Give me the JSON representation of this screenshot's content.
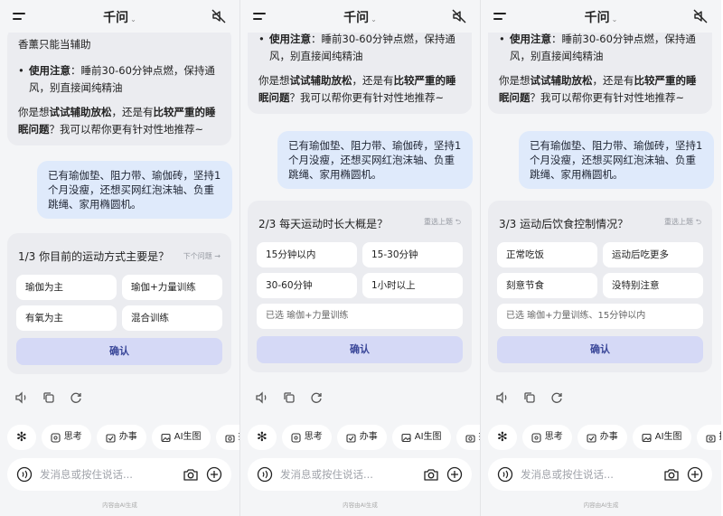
{
  "app": {
    "title": "千问",
    "title_caret": "⌄"
  },
  "common": {
    "input_placeholder": "发消息或按住说话...",
    "footer": "内容由AI生成",
    "chips": [
      "",
      "思考",
      "办事",
      "AI生图",
      "拍题"
    ],
    "confirm_label": "确认",
    "accent_color": "#d5d9f6",
    "user_bubble_color": "#dfeafb"
  },
  "screen1": {
    "ai_top": "香薰只能当辅助",
    "bullet_label": "使用注意",
    "bullet_text": "：睡前30-60分钟点燃，保持通风，别直接闻纯精油",
    "ask_pre": "你是想",
    "ask_b1": "试试辅助放松",
    "ask_mid": "，还是有",
    "ask_b2": "比较严重的睡眠问题",
    "ask_post": "？我可以帮你更有针对性地推荐~",
    "user_msg": "已有瑜伽垫、阻力带、瑜伽砖，坚持1个月没瘦，还想买网红泡沫轴、负重跳绳、家用椭圆机。",
    "question": "1/3 你目前的运动方式主要是？",
    "q_link": "下个问题 →",
    "options": [
      "瑜伽为主",
      "瑜伽+力量训练",
      "有氧为主",
      "混合训练"
    ]
  },
  "screen2": {
    "bullet_label": "使用注意",
    "bullet_text": "：睡前30-60分钟点燃，保持通风，别直接闻纯精油",
    "ask_pre": "你是想",
    "ask_b1": "试试辅助放松",
    "ask_mid": "，还是有",
    "ask_b2": "比较严重的睡眠问题",
    "ask_post": "？我可以帮你更有针对性地推荐~",
    "user_msg": "已有瑜伽垫、阻力带、瑜伽砖，坚持1个月没瘦，还想买网红泡沫轴、负重跳绳、家用椭圆机。",
    "question": "2/3 每天运动时长大概是？",
    "q_link": "重选上题 ⮌",
    "options": [
      "15分钟以内",
      "15-30分钟",
      "30-60分钟",
      "1小时以上"
    ],
    "selected": "已选  瑜伽+力量训练"
  },
  "screen3": {
    "bullet_label": "使用注意",
    "bullet_text": "：睡前30-60分钟点燃，保持通风，别直接闻纯精油",
    "ask_pre": "你是想",
    "ask_b1": "试试辅助放松",
    "ask_mid": "，还是有",
    "ask_b2": "比较严重的睡眠问题",
    "ask_post": "？我可以帮你更有针对性地推荐~",
    "user_msg": "已有瑜伽垫、阻力带、瑜伽砖，坚持1个月没瘦，还想买网红泡沫轴、负重跳绳、家用椭圆机。",
    "question": "3/3 运动后饮食控制情况？",
    "q_link": "重选上题 ⮌",
    "options": [
      "正常吃饭",
      "运动后吃更多",
      "刻意节食",
      "没特别注意"
    ],
    "selected": "已选  瑜伽+力量训练、15分钟以内"
  }
}
